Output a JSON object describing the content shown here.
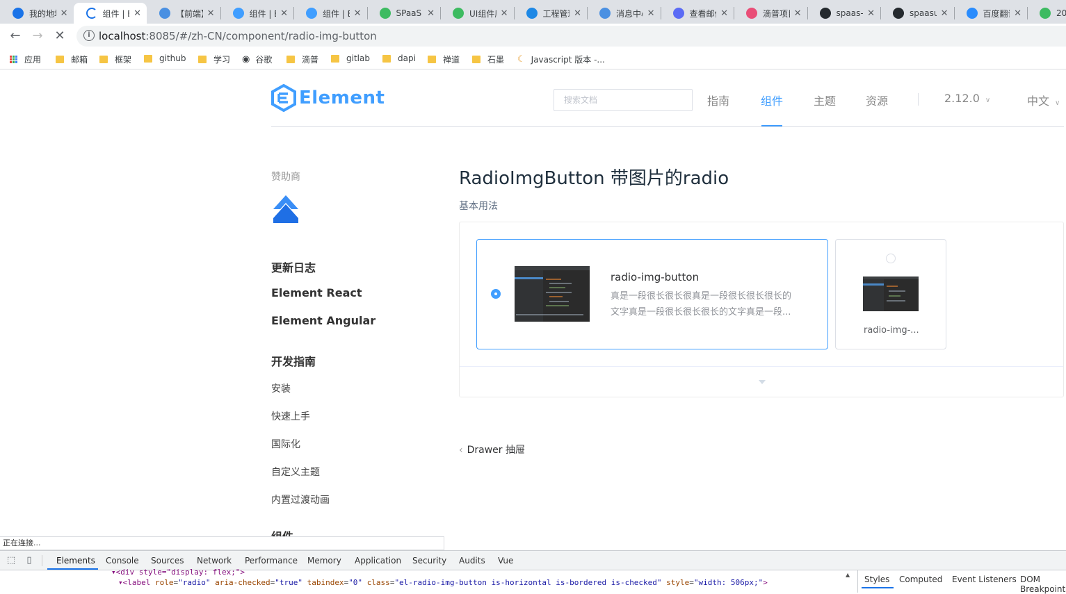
{
  "browser": {
    "tabs": [
      {
        "title": "我的地址",
        "color": "#1a73e8",
        "active": false
      },
      {
        "title": "组件 | Element",
        "color": "#1a73e8",
        "active": true
      },
      {
        "title": "【前端】",
        "color": "#4a90e2",
        "active": false
      },
      {
        "title": "组件 | Element",
        "color": "#409eff",
        "active": false
      },
      {
        "title": "组件 | Element",
        "color": "#409eff",
        "active": false
      },
      {
        "title": "SPaaS",
        "color": "#3dbb61",
        "active": false
      },
      {
        "title": "UI组件库",
        "color": "#3dbb61",
        "active": false
      },
      {
        "title": "工程管理",
        "color": "#1e88e5",
        "active": false
      },
      {
        "title": "消息中心",
        "color": "#4a90e2",
        "active": false
      },
      {
        "title": "查看邮件",
        "color": "#5b6bf5",
        "active": false
      },
      {
        "title": "滴普项目",
        "color": "#e94e77",
        "active": false
      },
      {
        "title": "spaas-ui",
        "color": "#24292e",
        "active": false
      },
      {
        "title": "spaasui",
        "color": "#24292e",
        "active": false
      },
      {
        "title": "百度翻译",
        "color": "#2a8cfd",
        "active": false
      },
      {
        "title": "20",
        "color": "#3dbb61",
        "active": false
      }
    ],
    "url_host": "localhost",
    "url_path": ":8085/#/zh-CN/component/radio-img-button",
    "bookmarks": [
      {
        "label": "应用",
        "kind": "apps"
      },
      {
        "label": "邮箱",
        "kind": "folder"
      },
      {
        "label": "框架",
        "kind": "folder"
      },
      {
        "label": "github",
        "kind": "folder"
      },
      {
        "label": "学习",
        "kind": "folder"
      },
      {
        "label": "谷歌",
        "kind": "globe"
      },
      {
        "label": "滴普",
        "kind": "folder"
      },
      {
        "label": "gitlab",
        "kind": "folder"
      },
      {
        "label": "dapi",
        "kind": "folder"
      },
      {
        "label": "禅道",
        "kind": "folder"
      },
      {
        "label": "石墨",
        "kind": "folder"
      },
      {
        "label": "Javascript 版本 -...",
        "kind": "page"
      }
    ],
    "status_text": "正在连接..."
  },
  "header": {
    "logo_text": "Element",
    "search_placeholder": "搜索文档",
    "nav": [
      "指南",
      "组件",
      "主题",
      "资源"
    ],
    "active_nav": "组件",
    "version": "2.12.0",
    "language": "中文"
  },
  "sidebar": {
    "sponsor_label": "赞助商",
    "links": [
      "更新日志",
      "Element React",
      "Element Angular"
    ],
    "dev_guide_title": "开发指南",
    "dev_guide_items": [
      "安装",
      "快速上手",
      "国际化",
      "自定义主题",
      "内置过渡动画"
    ],
    "components_title": "组件"
  },
  "main": {
    "title": "RadioImgButton 带图片的radio",
    "subtitle": "基本用法",
    "options": [
      {
        "title": "radio-img-button",
        "desc_line1": "真是一段很长很长很真是一段很长很长很长的",
        "desc_line2": "文字真是一段很长很长很长的文字真是一段...",
        "checked": true
      },
      {
        "title": "radio-img-...",
        "checked": false
      }
    ],
    "prev_link": "Drawer 抽屉"
  },
  "devtools": {
    "tabs": [
      "Elements",
      "Console",
      "Sources",
      "Network",
      "Performance",
      "Memory",
      "Application",
      "Security",
      "Audits",
      "Vue"
    ],
    "active_tab": "Elements",
    "code_line1": "<div style=\"display: flex;\">",
    "code_line2": {
      "open": "<label",
      "attrs": [
        {
          "name": "role",
          "value": "\"radio\""
        },
        {
          "name": "aria-checked",
          "value": "\"true\""
        },
        {
          "name": "tabindex",
          "value": "\"0\""
        },
        {
          "name": "class",
          "value": "\"el-radio-img-button is-horizontal is-bordered is-checked\""
        },
        {
          "name": "style",
          "value": "\"width: 506px;\""
        }
      ],
      "close": ">"
    },
    "right_tabs": [
      "Styles",
      "Computed",
      "Event Listeners",
      "DOM Breakpoints"
    ]
  },
  "colors": {
    "brand": "#409eff",
    "tab_bar": "#dee1e6"
  }
}
